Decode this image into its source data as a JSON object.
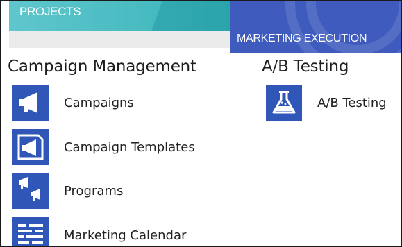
{
  "tiles": {
    "projects": "PROJECTS",
    "marketing_execution": "MARKETING EXECUTION"
  },
  "sections": {
    "campaign_management": {
      "title": "Campaign Management",
      "items": [
        {
          "label": "Campaigns",
          "icon": "megaphone-icon"
        },
        {
          "label": "Campaign Templates",
          "icon": "megaphone-template-icon"
        },
        {
          "label": "Programs",
          "icon": "multi-megaphone-icon"
        },
        {
          "label": "Marketing Calendar",
          "icon": "calendar-icon"
        }
      ]
    },
    "ab_testing": {
      "title": "A/B Testing",
      "items": [
        {
          "label": "A/B Testing",
          "icon": "flask-icon"
        }
      ]
    }
  },
  "colors": {
    "projects_tile": "#45bbc0",
    "marketing_tile": "#3e5bbd",
    "icon_bg": "#3056b8"
  }
}
